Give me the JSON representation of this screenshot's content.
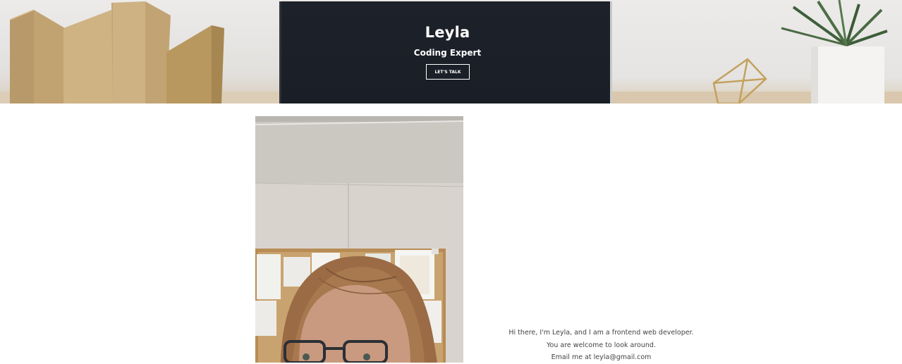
{
  "hero": {
    "name": "Leyla",
    "title": "Coding Expert",
    "cta_label": "LET'S TALK"
  },
  "about": {
    "line1": "Hi there, I'm Leyla, and I am a frontend web developer.",
    "line2": "You are welcome to look around.",
    "line3": "Email me at leyla@gmail.com"
  },
  "colors": {
    "hero_dark": "#1b1f27",
    "text_body": "#444444",
    "button_border": "#ffffff"
  }
}
